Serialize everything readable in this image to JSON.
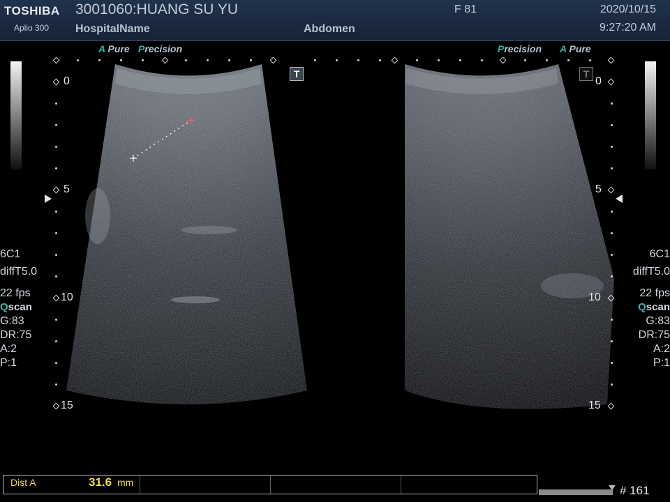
{
  "header": {
    "brand": "TOSHIBA",
    "model": "Aplio 300",
    "patient": "3001060:HUANG SU YU",
    "hospital": "HospitalName",
    "sex_age": "F  81",
    "exam": "Abdomen",
    "date": "2020/10/15",
    "time": "9:27:20 AM"
  },
  "labels": {
    "a_letter": "A",
    "pure": "Pure",
    "p_letter": "P",
    "recision": "recision",
    "t": "T"
  },
  "depth_marks": [
    "0",
    "5",
    "10",
    "15"
  ],
  "params": {
    "probe": "6C1",
    "mode": "diffT5.0",
    "fps": "22 fps",
    "q": "Q",
    "scan": "scan",
    "gain": "G:83",
    "dr": "DR:75",
    "a": "A:2",
    "p": "P:1"
  },
  "measurement": {
    "name": "Dist A",
    "value": "31.6",
    "unit": "mm"
  },
  "frame_number": "# 161",
  "colors": {
    "accent_teal": "#34b3a8",
    "measurement_yellow": "#f0e040",
    "header_bg": "#1b2a40"
  }
}
